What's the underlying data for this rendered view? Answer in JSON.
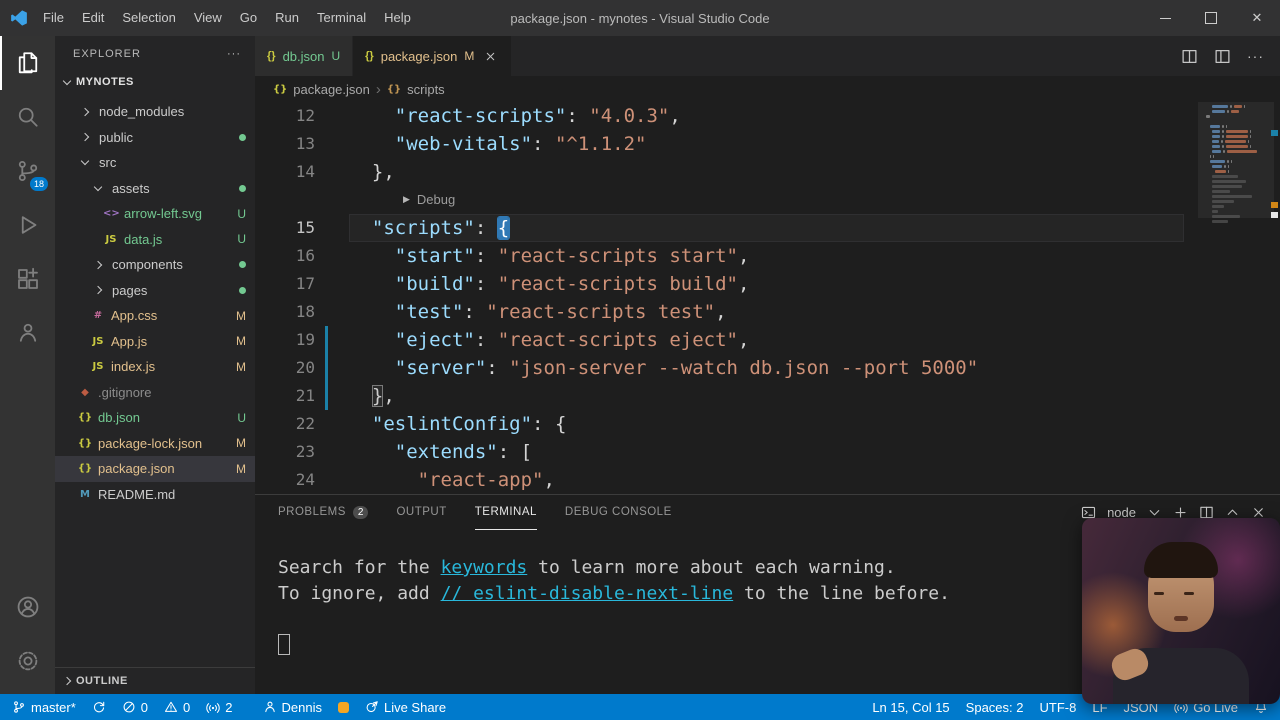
{
  "window": {
    "title": "package.json - mynotes - Visual Studio Code",
    "menus": [
      "File",
      "Edit",
      "Selection",
      "View",
      "Go",
      "Run",
      "Terminal",
      "Help"
    ]
  },
  "activity_bar": {
    "top": [
      {
        "name": "explorer",
        "active": true
      },
      {
        "name": "search",
        "active": false
      },
      {
        "name": "source-control",
        "active": false,
        "badge": "18"
      },
      {
        "name": "run-debug",
        "active": false
      },
      {
        "name": "extensions",
        "active": false
      },
      {
        "name": "live-share",
        "active": false
      }
    ],
    "bottom": [
      {
        "name": "account",
        "active": false
      },
      {
        "name": "settings",
        "active": false
      }
    ]
  },
  "sidebar": {
    "header": "EXPLORER",
    "section": "MYNOTES",
    "outline": "OUTLINE",
    "tree": [
      {
        "label": "node_modules",
        "type": "folder",
        "depth": 0,
        "state": "collapsed"
      },
      {
        "label": "public",
        "type": "folder",
        "depth": 0,
        "state": "collapsed",
        "dot": "#73c991"
      },
      {
        "label": "src",
        "type": "folder",
        "depth": 0,
        "state": "expanded"
      },
      {
        "label": "assets",
        "type": "folder",
        "depth": 1,
        "state": "expanded",
        "dot": "#73c991"
      },
      {
        "label": "arrow-left.svg",
        "type": "file",
        "icon": "svg",
        "depth": 2,
        "status": "U",
        "color": "#73c991"
      },
      {
        "label": "data.js",
        "type": "file",
        "icon": "js",
        "depth": 2,
        "status": "U",
        "color": "#73c991"
      },
      {
        "label": "components",
        "type": "folder",
        "depth": 1,
        "state": "collapsed",
        "dot": "#73c991"
      },
      {
        "label": "pages",
        "type": "folder",
        "depth": 1,
        "state": "collapsed",
        "dot": "#73c991"
      },
      {
        "label": "App.css",
        "type": "file",
        "icon": "css",
        "depth": 1,
        "status": "M",
        "color": "#e2c08d"
      },
      {
        "label": "App.js",
        "type": "file",
        "icon": "js",
        "depth": 1,
        "status": "M",
        "color": "#e2c08d"
      },
      {
        "label": "index.js",
        "type": "file",
        "icon": "js",
        "depth": 1,
        "status": "M",
        "color": "#e2c08d"
      },
      {
        "label": ".gitignore",
        "type": "file",
        "icon": "git",
        "depth": 0,
        "status": "",
        "color": "#8c8c8c"
      },
      {
        "label": "db.json",
        "type": "file",
        "icon": "json",
        "depth": 0,
        "status": "U",
        "color": "#73c991"
      },
      {
        "label": "package-lock.json",
        "type": "file",
        "icon": "json",
        "depth": 0,
        "status": "M",
        "color": "#e2c08d"
      },
      {
        "label": "package.json",
        "type": "file",
        "icon": "json",
        "depth": 0,
        "status": "M",
        "color": "#e2c08d",
        "selected": true
      },
      {
        "label": "README.md",
        "type": "file",
        "icon": "md",
        "depth": 0,
        "status": "",
        "color": "#cccccc"
      }
    ]
  },
  "editor_tabs": [
    {
      "label": "db.json",
      "icon": "json",
      "status": "U",
      "status_color": "#73c991",
      "label_color": "#73c991",
      "active": false,
      "closable": false
    },
    {
      "label": "package.json",
      "icon": "json",
      "status": "M",
      "status_color": "#e2c08d",
      "label_color": "#e2c08d",
      "active": true,
      "closable": true
    }
  ],
  "breadcrumb": {
    "file": "package.json",
    "symbol": "scripts"
  },
  "editor": {
    "lines": [
      {
        "num": "12",
        "segs": [
          [
            "    ",
            "p"
          ],
          [
            "\"react-scripts\"",
            "k"
          ],
          [
            ": ",
            "p"
          ],
          [
            "\"4.0.3\"",
            "s"
          ],
          [
            ",",
            "p"
          ]
        ]
      },
      {
        "num": "13",
        "segs": [
          [
            "    ",
            "p"
          ],
          [
            "\"web-vitals\"",
            "k"
          ],
          [
            ": ",
            "p"
          ],
          [
            "\"^1.1.2\"",
            "s"
          ]
        ]
      },
      {
        "num": "14",
        "segs": [
          [
            "  },",
            "p"
          ]
        ]
      },
      {
        "lens": "Debug"
      },
      {
        "num": "15",
        "current": true,
        "segs": [
          [
            "  ",
            "p"
          ],
          [
            "\"scripts\"",
            "k"
          ],
          [
            ": ",
            "p"
          ],
          [
            "{",
            "curb"
          ]
        ]
      },
      {
        "num": "16",
        "segs": [
          [
            "    ",
            "p"
          ],
          [
            "\"start\"",
            "k"
          ],
          [
            ": ",
            "p"
          ],
          [
            "\"react-scripts start\"",
            "s"
          ],
          [
            ",",
            "p"
          ]
        ]
      },
      {
        "num": "17",
        "segs": [
          [
            "    ",
            "p"
          ],
          [
            "\"build\"",
            "k"
          ],
          [
            ": ",
            "p"
          ],
          [
            "\"react-scripts build\"",
            "s"
          ],
          [
            ",",
            "p"
          ]
        ]
      },
      {
        "num": "18",
        "segs": [
          [
            "    ",
            "p"
          ],
          [
            "\"test\"",
            "k"
          ],
          [
            ": ",
            "p"
          ],
          [
            "\"react-scripts test\"",
            "s"
          ],
          [
            ",",
            "p"
          ]
        ]
      },
      {
        "num": "19",
        "mod": true,
        "segs": [
          [
            "    ",
            "p"
          ],
          [
            "\"eject\"",
            "k"
          ],
          [
            ": ",
            "p"
          ],
          [
            "\"react-scripts eject\"",
            "s"
          ],
          [
            ",",
            "p"
          ]
        ]
      },
      {
        "num": "20",
        "mod": true,
        "segs": [
          [
            "    ",
            "p"
          ],
          [
            "\"server\"",
            "k"
          ],
          [
            ": ",
            "p"
          ],
          [
            "\"json-server --watch db.json --port 5000\"",
            "s"
          ]
        ]
      },
      {
        "num": "21",
        "mod": true,
        "segs": [
          [
            "  ",
            "p"
          ],
          [
            "}",
            "bm"
          ],
          [
            ",",
            "p"
          ]
        ]
      },
      {
        "num": "22",
        "segs": [
          [
            "  ",
            "p"
          ],
          [
            "\"eslintConfig\"",
            "k"
          ],
          [
            ": ",
            "p"
          ],
          [
            "{",
            "p"
          ]
        ]
      },
      {
        "num": "23",
        "segs": [
          [
            "    ",
            "p"
          ],
          [
            "\"extends\"",
            "k"
          ],
          [
            ": ",
            "p"
          ],
          [
            "[",
            "p"
          ]
        ]
      },
      {
        "num": "24",
        "segs": [
          [
            "      ",
            "p"
          ],
          [
            "\"react-app\"",
            "s"
          ],
          [
            ",",
            "p"
          ]
        ]
      }
    ]
  },
  "panel": {
    "tabs": [
      {
        "label": "PROBLEMS",
        "badge": "2",
        "active": false
      },
      {
        "label": "OUTPUT",
        "active": false
      },
      {
        "label": "TERMINAL",
        "active": true
      },
      {
        "label": "DEBUG CONSOLE",
        "active": false
      }
    ],
    "shell_label": "node",
    "terminal": [
      {
        "segs": [
          [
            "Search for the ",
            "t"
          ],
          [
            "keywords",
            "link"
          ],
          [
            " to learn more about each warning.",
            "t"
          ]
        ]
      },
      {
        "segs": [
          [
            "To ignore, add ",
            "t"
          ],
          [
            "// eslint-disable-next-line",
            "link"
          ],
          [
            " to the line before.",
            "t"
          ]
        ]
      }
    ]
  },
  "status_bar": {
    "left": [
      {
        "name": "branch-indicator",
        "icon": "branch",
        "label": "master*"
      },
      {
        "name": "sync-indicator",
        "icon": "sync",
        "label": ""
      },
      {
        "name": "problems-errors",
        "icon": "error",
        "label": "0"
      },
      {
        "name": "problems-warnings",
        "icon": "warning",
        "label": "0"
      },
      {
        "name": "screencast-count",
        "icon": "broadcast",
        "label": "2"
      },
      {
        "name": "live-share-user",
        "icon": "person",
        "label": "Dennis",
        "gap": true
      },
      {
        "name": "extension-alert",
        "icon": "orange-badge",
        "label": ""
      },
      {
        "name": "live-share-button",
        "icon": "share",
        "label": "Live Share"
      }
    ],
    "right": [
      {
        "name": "cursor-position",
        "label": "Ln 15, Col 15"
      },
      {
        "name": "indentation-setting",
        "label": "Spaces: 2"
      },
      {
        "name": "encoding-indicator",
        "label": "UTF-8"
      },
      {
        "name": "eol-indicator",
        "label": "LF"
      },
      {
        "name": "language-mode",
        "label": "JSON"
      },
      {
        "name": "go-live-button",
        "icon": "broadcast",
        "label": "Go Live"
      },
      {
        "name": "notifications-bell",
        "icon": "bell",
        "label": ""
      }
    ]
  }
}
